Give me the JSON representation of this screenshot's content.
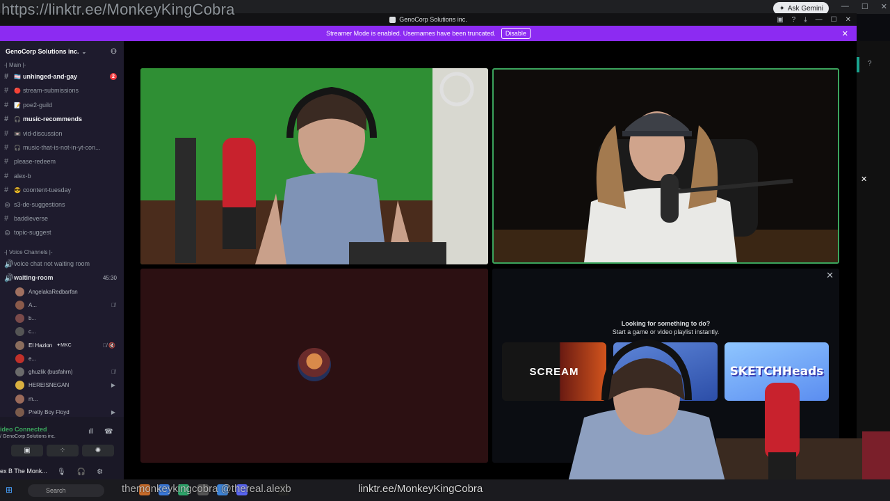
{
  "overlay": {
    "link_top": "https://linktr.ee/MonkeyKingCobra",
    "bottom_handles": "themonkeykingcobra  @thereal.alexb",
    "bottom_link": "linktr.ee/MonkeyKingCobra"
  },
  "browser": {
    "gemini_label": "Ask Gemini"
  },
  "titlebar": {
    "title": "GenoCorp Solutions inc."
  },
  "banner": {
    "text": "Streamer Mode is enabled. Usernames have been truncated.",
    "button": "Disable"
  },
  "sidebar": {
    "server_name": "GenoCorp Solutions inc.",
    "category_main": "-| Main |-",
    "channels": [
      {
        "emoji": "🏳️‍⚧️",
        "name": "unhinged-and-gay",
        "bold": true,
        "mention": "2"
      },
      {
        "emoji": "🔴",
        "name": "stream-submissions"
      },
      {
        "emoji": "📝",
        "name": "poe2-guild"
      },
      {
        "emoji": "🎧",
        "name": "music-recommends",
        "bold": true
      },
      {
        "emoji": "📼",
        "name": "vid-discussion"
      },
      {
        "emoji": "🎧",
        "name": "music-that-is-not-in-yt-con..."
      },
      {
        "emoji": "",
        "name": "please-redeem"
      },
      {
        "emoji": "",
        "name": "alex-b"
      },
      {
        "emoji": "😎",
        "name": "coontent-tuesday"
      },
      {
        "emoji": "",
        "name": "s3-de-suggestions"
      },
      {
        "emoji": "",
        "name": "baddieverse"
      },
      {
        "emoji": "",
        "name": "topic-suggest"
      }
    ],
    "category_voice": "-| Voice Channels |-",
    "voice_channels": [
      {
        "name": "voice chat not waiting room"
      },
      {
        "name": "waiting-room",
        "time": "45:30"
      }
    ],
    "voice_users": [
      {
        "name": "AngelakaRedbarfan",
        "icon": ""
      },
      {
        "name": "A...",
        "icon": "🎙̸"
      },
      {
        "name": "b...",
        "icon": ""
      },
      {
        "name": "c...",
        "icon": ""
      },
      {
        "name": "El Hazion",
        "tag": "✦MKC",
        "icon": "🎙̸ 🔇"
      },
      {
        "name": "e...",
        "icon": ""
      },
      {
        "name": "ghuzlik (busfahrn)",
        "icon": "🎙̸"
      },
      {
        "name": "HEREISNEGAN",
        "icon": "▶"
      },
      {
        "name": "m...",
        "icon": ""
      },
      {
        "name": "Pretty Boy Floyd",
        "icon": "▶"
      }
    ]
  },
  "voice_panel": {
    "status": "ideo Connected",
    "sub": "/ GenoCorp Solutions inc.",
    "user": "ex B The Monk..."
  },
  "activity": {
    "question": "Looking for something to do?",
    "sub": "Start a game or video playlist instantly.",
    "card1": "SCREAM",
    "card3": "SKETCHHeads"
  },
  "taskbar": {
    "search": "Search"
  }
}
